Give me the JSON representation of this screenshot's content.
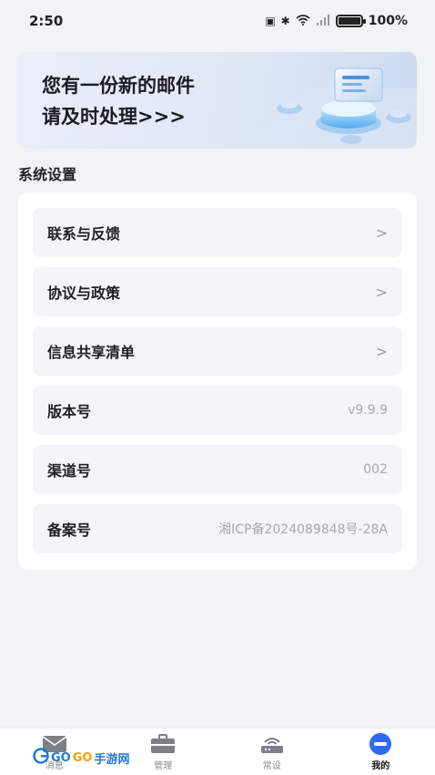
{
  "status_bar": {
    "time": "2:50",
    "battery": "100%"
  },
  "banner": {
    "line1": "您有一份新的邮件",
    "line2": "请及时处理>>>"
  },
  "section_title": "系统设置",
  "settings": [
    {
      "label": "联系与反馈",
      "value": "",
      "chevron": ">"
    },
    {
      "label": "协议与政策",
      "value": "",
      "chevron": ">"
    },
    {
      "label": "信息共享清单",
      "value": "",
      "chevron": ">"
    },
    {
      "label": "版本号",
      "value": "v9.9.9",
      "chevron": ""
    },
    {
      "label": "渠道号",
      "value": "002",
      "chevron": ""
    },
    {
      "label": "备案号",
      "value": "湘ICP备2024089848号-28A",
      "chevron": ""
    }
  ],
  "tabs": [
    {
      "label": "消息",
      "icon": "mail-icon"
    },
    {
      "label": "管理",
      "icon": "briefcase-icon"
    },
    {
      "label": "常设",
      "icon": "router-icon"
    },
    {
      "label": "我的",
      "icon": "profile-icon",
      "active": true
    }
  ],
  "watermark": {
    "part1": "GO",
    "part2": "GO",
    "part3": "手游网"
  },
  "colors": {
    "background": "#f2f3f7",
    "accent": "#2f6bf2"
  }
}
